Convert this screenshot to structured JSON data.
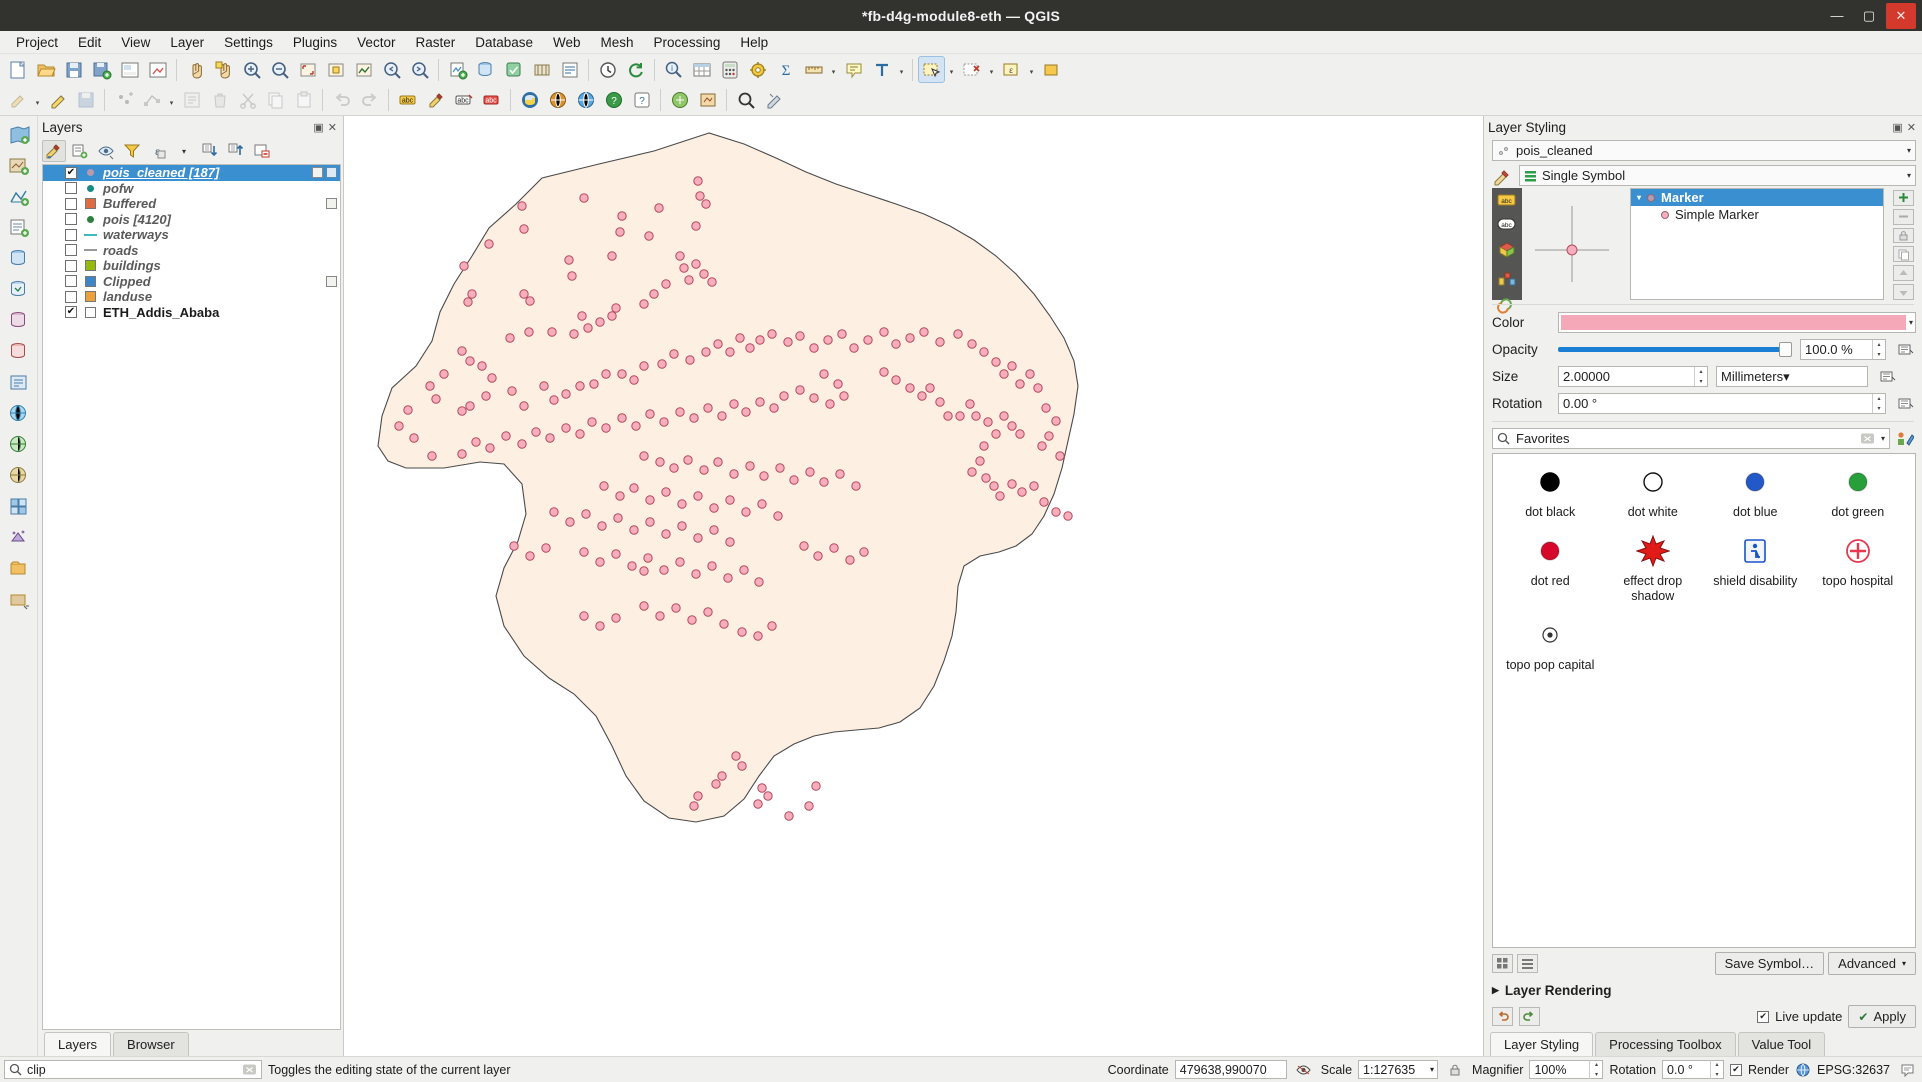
{
  "window": {
    "title": "*fb-d4g-module8-eth — QGIS",
    "minimize": "—",
    "maximize": "▢",
    "close": "✕"
  },
  "menubar": {
    "items": [
      "Project",
      "Edit",
      "View",
      "Layer",
      "Settings",
      "Plugins",
      "Vector",
      "Raster",
      "Database",
      "Web",
      "Mesh",
      "Processing",
      "Help"
    ]
  },
  "layers_panel": {
    "title": "Layers",
    "toolbar_icons": [
      "open-layer-styling-panel-icon",
      "add-group-icon",
      "manage-map-themes-icon",
      "filter-legend-icon",
      "filter-legend-by-expression-icon",
      "expand-all-icon",
      "collapse-all-icon",
      "remove-layer-icon"
    ],
    "rows": [
      {
        "name": "pois_cleaned [187]",
        "checked": true,
        "selected": true,
        "symbol": "point",
        "color": "#b79ab0",
        "extra": [
          "edit-indicator",
          "filter-indicator"
        ]
      },
      {
        "name": "pofw",
        "checked": false,
        "selected": false,
        "symbol": "point",
        "color": "#1a8a82",
        "extra": []
      },
      {
        "name": "Buffered",
        "checked": false,
        "selected": false,
        "symbol": "square",
        "color": "#e06a42",
        "extra": [
          "memory-indicator"
        ]
      },
      {
        "name": "pois [4120]",
        "checked": false,
        "selected": false,
        "symbol": "point",
        "color": "#2f7f3e",
        "extra": []
      },
      {
        "name": "waterways",
        "checked": false,
        "selected": false,
        "symbol": "line",
        "color": "#3fb8c0",
        "extra": []
      },
      {
        "name": "roads",
        "checked": false,
        "selected": false,
        "symbol": "line",
        "color": "#9a9a9a",
        "extra": []
      },
      {
        "name": "buildings",
        "checked": false,
        "selected": false,
        "symbol": "square",
        "color": "#96ba0a",
        "extra": []
      },
      {
        "name": "Clipped",
        "checked": false,
        "selected": false,
        "symbol": "square",
        "color": "#3e84c8",
        "extra": [
          "memory-indicator"
        ]
      },
      {
        "name": "landuse",
        "checked": false,
        "selected": false,
        "symbol": "square",
        "color": "#e9a13a",
        "extra": []
      },
      {
        "name": "ETH_Addis_Ababa",
        "checked": true,
        "selected": false,
        "symbol": "square",
        "color": "#ffffff",
        "plain": true,
        "extra": []
      }
    ],
    "tabs": [
      {
        "label": "Layers",
        "active": true
      },
      {
        "label": "Browser",
        "active": false
      }
    ]
  },
  "style_panel": {
    "title": "Layer Styling",
    "layer_combo": "pois_cleaned",
    "renderer_combo": "Single Symbol",
    "symbol_tree": [
      {
        "label": "Marker",
        "level": 0,
        "selected": true
      },
      {
        "label": "Simple Marker",
        "level": 1,
        "selected": false
      }
    ],
    "properties": {
      "color_label": "Color",
      "color_value": "#f4a8b8",
      "opacity_label": "Opacity",
      "opacity_value": "100.0 %",
      "size_label": "Size",
      "size_value": "2.00000",
      "size_unit": "Millimeters",
      "rotation_label": "Rotation",
      "rotation_value": "0.00 °"
    },
    "search_placeholder": "Favorites",
    "gallery": [
      {
        "label": "dot black",
        "icon": "dot-black-icon",
        "color": "#000000"
      },
      {
        "label": "dot white",
        "icon": "dot-white-icon",
        "color": "#ffffff"
      },
      {
        "label": "dot blue",
        "icon": "dot-blue-icon",
        "color": "#2358c8"
      },
      {
        "label": "dot green",
        "icon": "dot-green-icon",
        "color": "#27a03c"
      },
      {
        "label": "dot red",
        "icon": "dot-red-icon",
        "color": "#d6072a"
      },
      {
        "label": "effect drop shadow",
        "icon": "effect-drop-shadow-icon",
        "color": "#e01b18"
      },
      {
        "label": "shield disability",
        "icon": "shield-disability-icon",
        "color": "#1a53c8"
      },
      {
        "label": "topo hospital",
        "icon": "topo-hospital-icon",
        "color": "#e8384f"
      },
      {
        "label": "topo pop capital",
        "icon": "topo-pop-capital-icon",
        "color": "#333333"
      }
    ],
    "save_symbol_label": "Save Symbol…",
    "advanced_label": "Advanced",
    "layer_rendering_label": "Layer Rendering",
    "live_update_label": "Live update",
    "apply_label": "Apply",
    "tabs": [
      {
        "label": "Layer Styling",
        "active": true
      },
      {
        "label": "Processing Toolbox",
        "active": false
      },
      {
        "label": "Value Tool",
        "active": false
      }
    ]
  },
  "statusbar": {
    "search_value": "clip",
    "message": "Toggles the editing state of the current layer",
    "coordinate_label": "Coordinate",
    "coordinate_value": "479638,990070",
    "scale_label": "Scale",
    "scale_value": "1:127635",
    "magnifier_label": "Magnifier",
    "magnifier_value": "100%",
    "rotation_label": "Rotation",
    "rotation_value": "0.0 °",
    "render_label": "Render",
    "crs_label": "EPSG:32637"
  },
  "map": {
    "fill_color": "#fdf0e3",
    "stroke_color": "#4a4a4a",
    "point_fill": "#f6aebc",
    "point_stroke": "#b44a5e"
  }
}
